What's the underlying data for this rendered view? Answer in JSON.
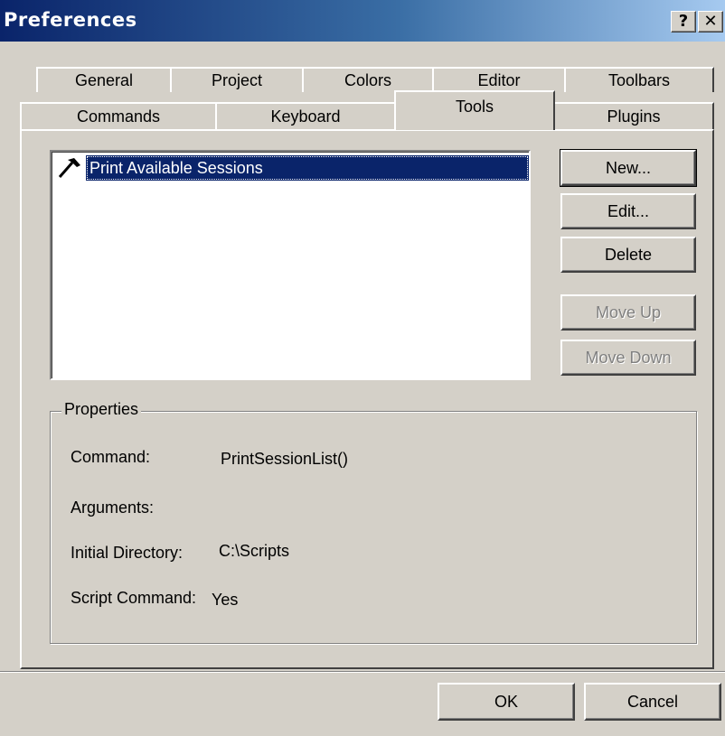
{
  "window": {
    "title": "Preferences",
    "help_label": "?",
    "close_label": "✕"
  },
  "tabs": {
    "back_row": [
      "General",
      "Project",
      "Colors",
      "Editor",
      "Toolbars"
    ],
    "front_row": [
      "Commands",
      "Keyboard",
      "Tools",
      "Plugins"
    ],
    "active": "Tools"
  },
  "tools_list": {
    "items": [
      {
        "label": "Print Available Sessions",
        "icon": "hammer-icon",
        "selected": true
      }
    ]
  },
  "buttons": {
    "new": "New...",
    "edit": "Edit...",
    "delete": "Delete",
    "move_up": "Move Up",
    "move_down": "Move Down",
    "ok": "OK",
    "cancel": "Cancel"
  },
  "properties": {
    "title": "Properties",
    "command_label": "Command:",
    "command_value": "PrintSessionList()",
    "arguments_label": "Arguments:",
    "arguments_value": "",
    "initial_directory_label": "Initial Directory:",
    "initial_directory_value": "C:\\Scripts",
    "script_command_label": "Script Command:",
    "script_command_value": "Yes"
  },
  "colors": {
    "face": "#d4d0c8",
    "selection": "#0a246a",
    "title_gradient_start": "#0a246a",
    "title_gradient_end": "#a6caf0"
  }
}
